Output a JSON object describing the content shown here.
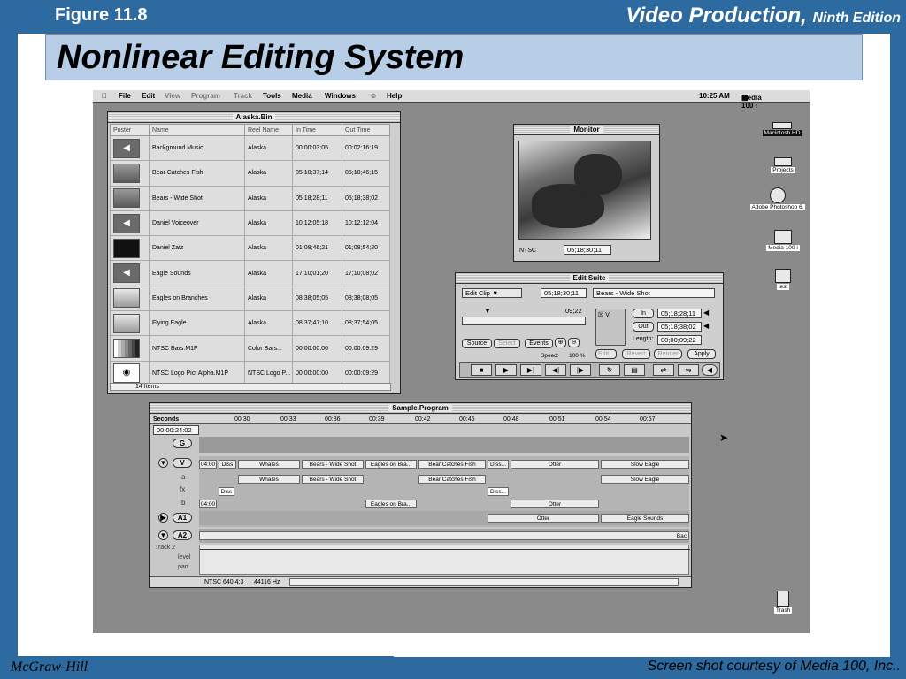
{
  "slide": {
    "figure": "Figure 11.8",
    "book_title": "Video Production,",
    "book_edition": "Ninth Edition",
    "heading": "Nonlinear Editing System",
    "publisher": "McGraw-Hill",
    "credit": "Screen shot courtesy of Media 100, Inc.."
  },
  "menubar": {
    "items": [
      "File",
      "Edit",
      "View",
      "Program",
      "Track",
      "Tools",
      "Media",
      "Windows",
      "Help"
    ],
    "time": "10:25 AM",
    "app": "Media 100 i"
  },
  "bin": {
    "title": "Alaska.Bin",
    "columns": [
      "Poster",
      "Name",
      "Reel Name",
      "In Time",
      "Out Time"
    ],
    "rows": [
      {
        "name": "Background Music",
        "reel": "Alaska",
        "in": "00:00:03:05",
        "out": "00:02:16:19",
        "thumb": "speaker"
      },
      {
        "name": "Bear Catches Fish",
        "reel": "Alaska",
        "in": "05;18;37;14",
        "out": "05;18;46;15",
        "thumb": "image"
      },
      {
        "name": "Bears - Wide Shot",
        "reel": "Alaska",
        "in": "05;18;28;11",
        "out": "05;18;38;02",
        "thumb": "image"
      },
      {
        "name": "Daniel Voiceover",
        "reel": "Alaska",
        "in": "10;12;05;18",
        "out": "10;12;12;04",
        "thumb": "speaker"
      },
      {
        "name": "Daniel Zatz",
        "reel": "Alaska",
        "in": "01;08;46;21",
        "out": "01;08;54;20",
        "thumb": "dark"
      },
      {
        "name": "Eagle Sounds",
        "reel": "Alaska",
        "in": "17;10;01;20",
        "out": "17;10;08;02",
        "thumb": "speaker"
      },
      {
        "name": "Eagles on Branches",
        "reel": "Alaska",
        "in": "08;38;05;05",
        "out": "08;38;08;05",
        "thumb": "light"
      },
      {
        "name": "Flying Eagle",
        "reel": "Alaska",
        "in": "08;37;47;10",
        "out": "08;37;54;05",
        "thumb": "light"
      },
      {
        "name": "NTSC Bars.M1P",
        "reel": "Color Bars...",
        "in": "00:00:00:00",
        "out": "00:00:09:29",
        "thumb": "bars"
      },
      {
        "name": "NTSC Logo Pict Alpha.M1P",
        "reel": "NTSC Logo P...",
        "in": "00:00:00:00",
        "out": "00:00:09:29",
        "thumb": "logo"
      }
    ],
    "count": "14",
    "count_label": "Items"
  },
  "monitor": {
    "title": "Monitor",
    "format": "NTSC",
    "timecode": "05;18;30;11"
  },
  "edit_suite": {
    "title": "Edit Suite",
    "mode": "Edit Clip",
    "timecode": "05;18;30;11",
    "clip_name": "Bears - Wide Shot",
    "duration": "09;22",
    "buttons": {
      "source": "Source",
      "select": "Select",
      "events": "Events",
      "edit": "Edit...",
      "revert": "Revert",
      "render": "Render",
      "apply": "Apply"
    },
    "track_v": "V",
    "in_label": "In",
    "out_label": "Out",
    "length_label": "Length:",
    "in_time": "05;18;28;11",
    "out_time": "05;18;38;02",
    "length": "00;00;09;22",
    "speed_label": "Speed:",
    "speed": "100 %"
  },
  "program": {
    "title": "Sample.Program",
    "seconds_label": "Seconds",
    "current_time": "00:00:24:02",
    "ruler": [
      "00:30",
      "00:33",
      "00:36",
      "00:39",
      "00:42",
      "00:45",
      "00:48",
      "00:51",
      "00:54",
      "00:57"
    ],
    "tracks": {
      "g": "G",
      "v": "V",
      "a": "a",
      "fx": "fx",
      "b": "b",
      "a1": "A1",
      "a2": "A2",
      "track2": "Track 2",
      "level": "level",
      "pan": "pan"
    },
    "v_clips": [
      "04:00",
      "Diss",
      "Whales",
      "Bears - Wide Shot",
      "Eagles on Bra...",
      "Bear Catches Fish",
      "Diss...",
      "Otter",
      "Slow Eagle"
    ],
    "a_clips": [
      "Whales",
      "Bears - Wide Shot",
      "Bear Catches Fish",
      "Slow Eagle"
    ],
    "fx_clips": [
      "Diss",
      "Diss..."
    ],
    "b_clips": [
      "04:00",
      "Eagles on Bra...",
      "Otter"
    ],
    "a1_clips": [
      "Otter",
      "Eagle Sounds"
    ],
    "a2_clip": "Bac",
    "status_format": "NTSC 640 4:3",
    "status_audio": "44116 Hz"
  },
  "desktop": {
    "icons": [
      "Macintosh HD",
      "Projects",
      "Adobe Photoshop 6.",
      "Media 100 i",
      "test",
      "Trash"
    ]
  }
}
